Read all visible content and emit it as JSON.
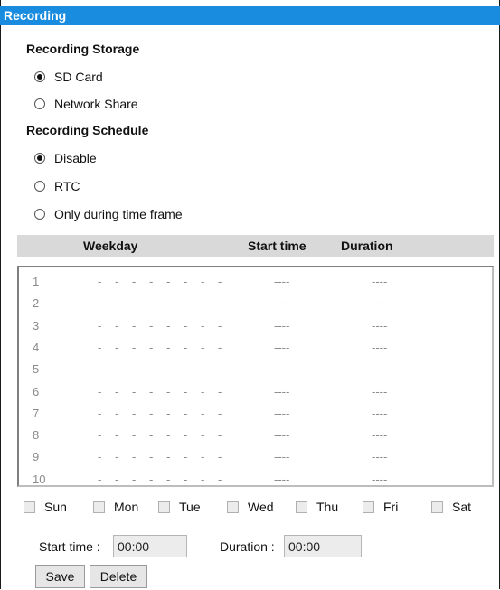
{
  "titlebar": {
    "title": "Recording"
  },
  "storage": {
    "heading": "Recording Storage",
    "options": [
      {
        "label": "SD Card",
        "checked": true
      },
      {
        "label": "Network Share",
        "checked": false
      }
    ]
  },
  "schedule": {
    "heading": "Recording Schedule",
    "options": [
      {
        "label": "Disable",
        "checked": true
      },
      {
        "label": "RTC",
        "checked": false
      },
      {
        "label": "Only during time frame",
        "checked": false
      }
    ]
  },
  "table": {
    "headers": {
      "weekday": "Weekday",
      "start_time": "Start time",
      "duration": "Duration"
    },
    "rows": [
      {
        "num": "1",
        "start": "----",
        "duration": "----"
      },
      {
        "num": "2",
        "start": "----",
        "duration": "----"
      },
      {
        "num": "3",
        "start": "----",
        "duration": "----"
      },
      {
        "num": "4",
        "start": "----",
        "duration": "----"
      },
      {
        "num": "5",
        "start": "----",
        "duration": "----"
      },
      {
        "num": "6",
        "start": "----",
        "duration": "----"
      },
      {
        "num": "7",
        "start": "----",
        "duration": "----"
      },
      {
        "num": "8",
        "start": "----",
        "duration": "----"
      },
      {
        "num": "9",
        "start": "----",
        "duration": "----"
      },
      {
        "num": "10",
        "start": "----",
        "duration": "----"
      }
    ],
    "weekday_placeholder": "-"
  },
  "days": [
    "Sun",
    "Mon",
    "Tue",
    "Wed",
    "Thu",
    "Fri",
    "Sat"
  ],
  "form": {
    "start_time_label": "Start time :",
    "start_time_value": "00:00",
    "duration_label": "Duration :",
    "duration_value": "00:00"
  },
  "buttons": {
    "save": "Save",
    "delete": "Delete"
  }
}
